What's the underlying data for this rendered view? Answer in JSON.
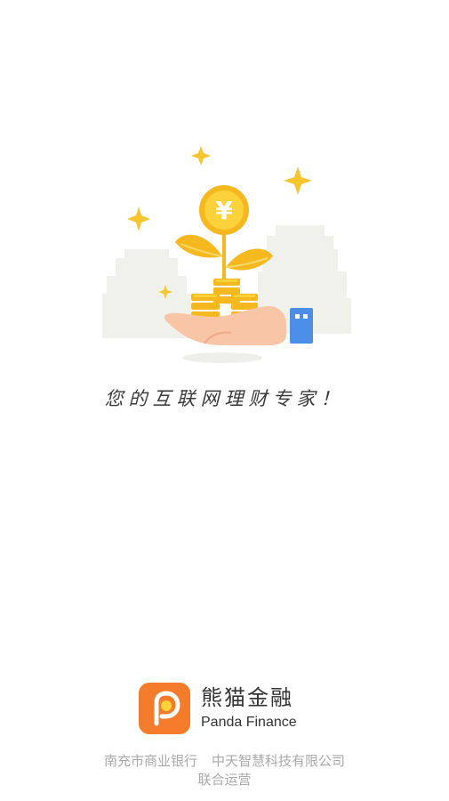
{
  "slogan": "您的互联网理财专家！",
  "brand": {
    "name_cn": "熊猫金融",
    "name_en": "Panda Finance",
    "logo_color": "#f47b2b"
  },
  "hero": {
    "coin_symbol": "¥",
    "coin_color": "#f7c52d",
    "leaf_color": "#f5b81f",
    "hand_color": "#f8c5a6",
    "cuff_color": "#4a8ee8"
  },
  "footer": {
    "operator_1": "南充市商业银行",
    "operator_2": "中天智慧科技有限公司",
    "joint": "联合运营"
  }
}
